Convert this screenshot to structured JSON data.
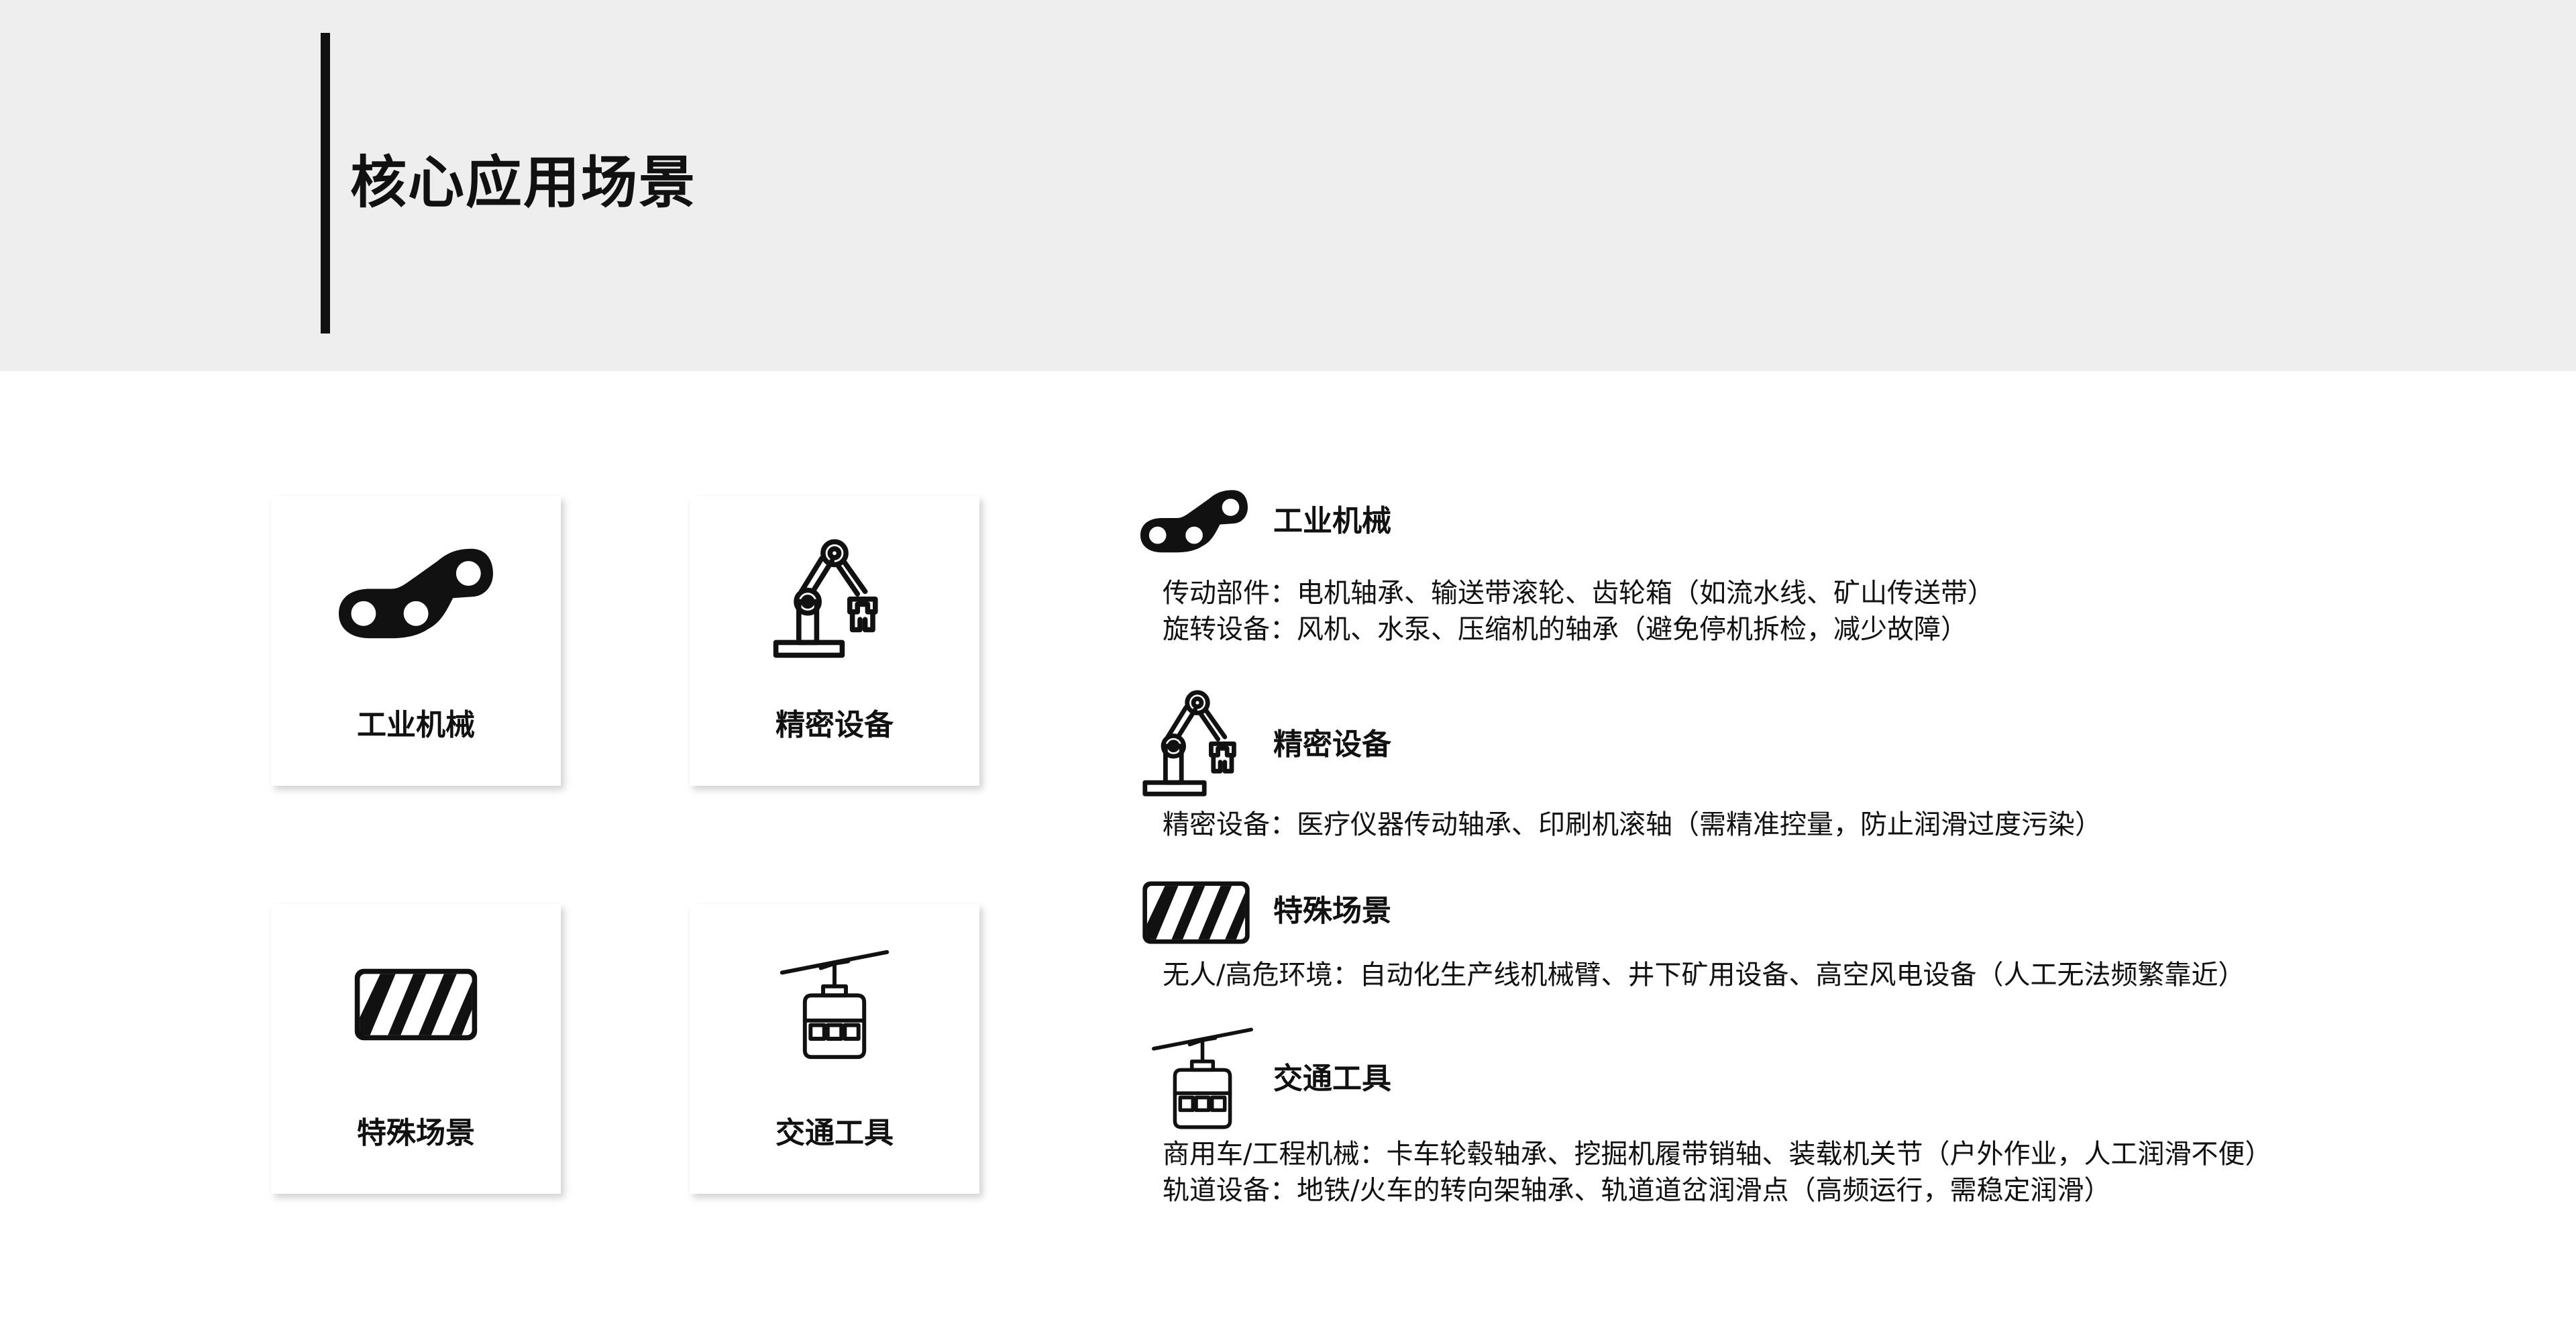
{
  "header": {
    "title": "核心应用场景"
  },
  "cards": [
    {
      "label": "工业机械",
      "icon": "chain-link-icon"
    },
    {
      "label": "精密设备",
      "icon": "robot-arm-icon"
    },
    {
      "label": "特殊场景",
      "icon": "hazard-stripes-icon"
    },
    {
      "label": "交通工具",
      "icon": "cable-car-icon"
    }
  ],
  "scenarios": [
    {
      "title": "工业机械",
      "icon": "chain-link-icon",
      "lines": [
        "传动部件：电机轴承、输送带滚轮、齿轮箱（如流水线、矿山传送带）",
        "旋转设备：风机、水泵、压缩机的轴承（避免停机拆检，减少故障）"
      ]
    },
    {
      "title": "精密设备",
      "icon": "robot-arm-icon",
      "lines": [
        "精密设备：医疗仪器传动轴承、印刷机滚轴（需精准控量，防止润滑过度污染）"
      ]
    },
    {
      "title": "特殊场景",
      "icon": "hazard-stripes-icon",
      "lines": [
        "无人/高危环境：自动化生产线机械臂、井下矿用设备、高空风电设备（人工无法频繁靠近）"
      ]
    },
    {
      "title": "交通工具",
      "icon": "cable-car-icon",
      "lines": [
        "商用车/工程机械：卡车轮毂轴承、挖掘机履带销轴、装载机关节（户外作业，人工润滑不便）",
        "轨道设备：地铁/火车的转向架轴承、轨道道岔润滑点（高频运行，需稳定润滑）"
      ]
    }
  ]
}
